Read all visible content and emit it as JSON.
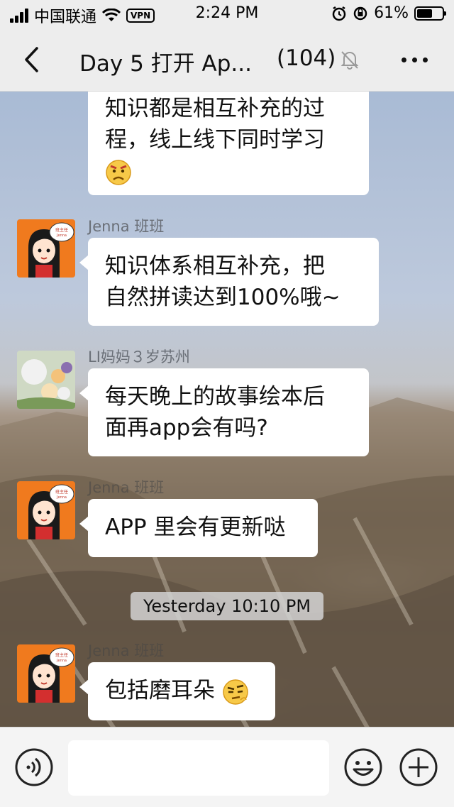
{
  "status_bar": {
    "carrier": "中国联通",
    "vpn": "VPN",
    "time": "2:24 PM",
    "battery": "61%",
    "battery_level": 0.61
  },
  "header": {
    "title": "Day 5 打开 Ap...",
    "count": "(104)"
  },
  "messages": [
    {
      "text": [
        "知识都是相互补充的过",
        "程，线上线下同时学习"
      ],
      "emoji": "frown-face"
    },
    {
      "sender": "Jenna 班班",
      "text": [
        "知识体系相互补充，把",
        "自然拼读达到100%哦~"
      ]
    },
    {
      "sender": "LI妈妈３岁苏州",
      "text": [
        "每天晚上的故事绘本后",
        "面再app会有吗?"
      ]
    },
    {
      "sender": "Jenna 班班",
      "text": [
        "APP 里会有更新哒"
      ]
    },
    {
      "sender": "Jenna 班班",
      "text": [
        "包括磨耳朵"
      ],
      "emoji": "skeptical-face"
    }
  ],
  "time_separator": "Yesterday 10:10 PM",
  "avatar_badge": {
    "label_top": "班主任",
    "label_bottom": "Jenna"
  },
  "colors": {
    "nav_bg": "#ededed",
    "bubble_bg": "#ffffff",
    "avatar_orange": "#f07a1e"
  }
}
